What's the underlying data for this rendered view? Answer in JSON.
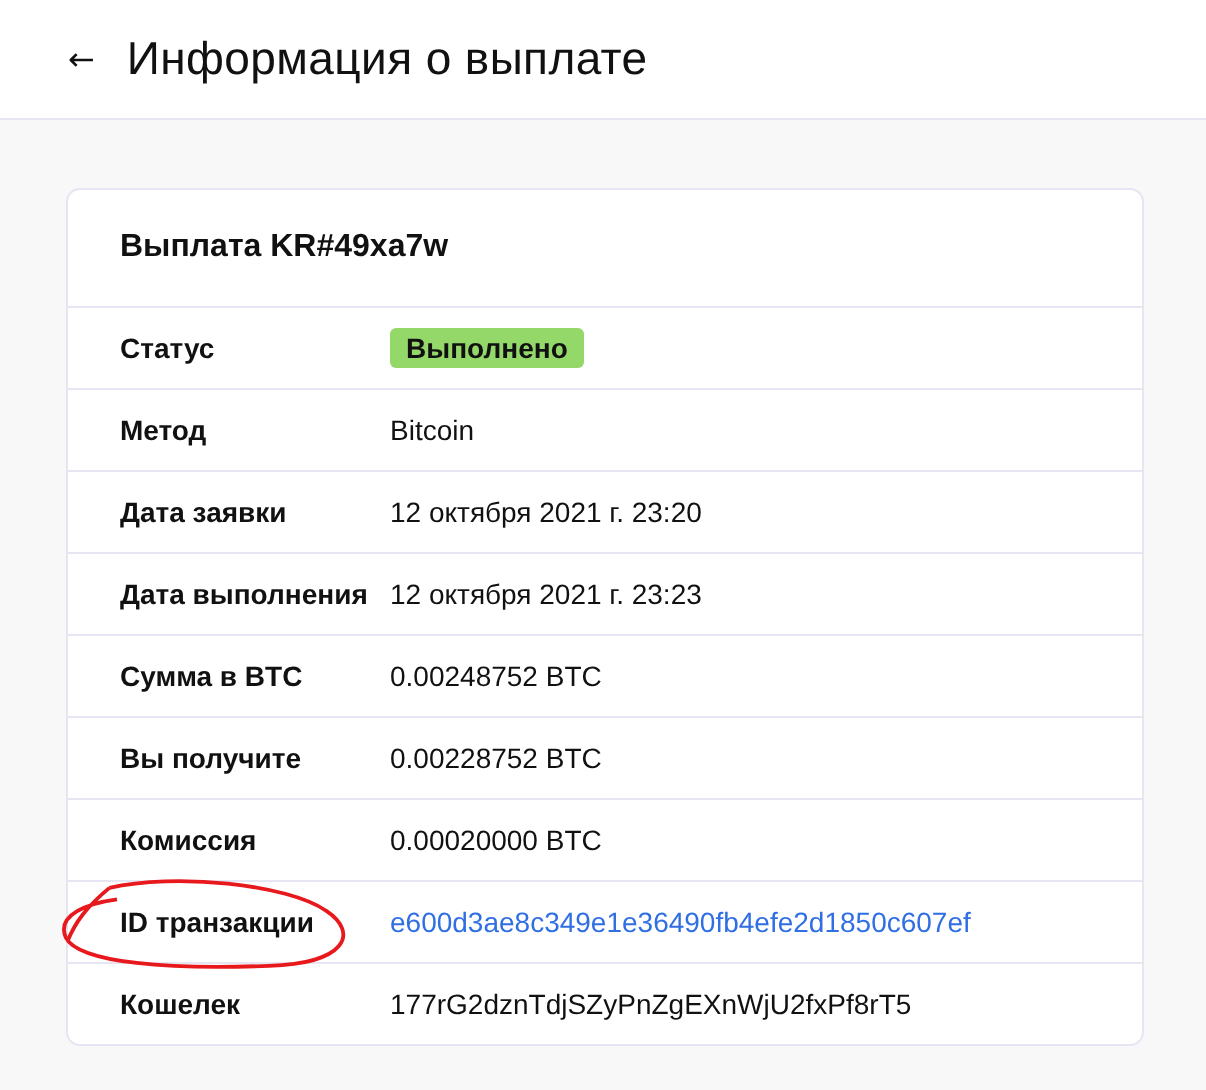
{
  "header": {
    "back": "←",
    "title": "Информация о выплате"
  },
  "card": {
    "title": "Выплата KR#49xa7w",
    "rows": [
      {
        "label": "Статус",
        "kind": "badge",
        "value": "Выполнено",
        "color": "#95d86a",
        "circled": false
      },
      {
        "label": "Метод",
        "kind": "text",
        "value": "Bitcoin",
        "circled": false
      },
      {
        "label": "Дата заявки",
        "kind": "text",
        "value": "12 октября 2021 г. 23:20",
        "circled": false
      },
      {
        "label": "Дата выполнения",
        "kind": "text",
        "value": "12 октября 2021 г. 23:23",
        "circled": false
      },
      {
        "label": "Сумма в BTC",
        "kind": "text",
        "value": "0.00248752 BTC",
        "circled": false
      },
      {
        "label": "Вы получите",
        "kind": "text",
        "value": "0.00228752 BTC",
        "circled": false
      },
      {
        "label": "Комиссия",
        "kind": "text",
        "value": "0.00020000 BTC",
        "circled": false
      },
      {
        "label": "ID транзакции",
        "kind": "link",
        "value": "e600d3ae8c349e1e36490fb4efe2d1850c607ef",
        "circled": true
      },
      {
        "label": "Кошелек",
        "kind": "text",
        "value": "177rG2dznTdjSZyPnZgEXnWjU2fxPf8rT5",
        "circled": false
      }
    ]
  }
}
